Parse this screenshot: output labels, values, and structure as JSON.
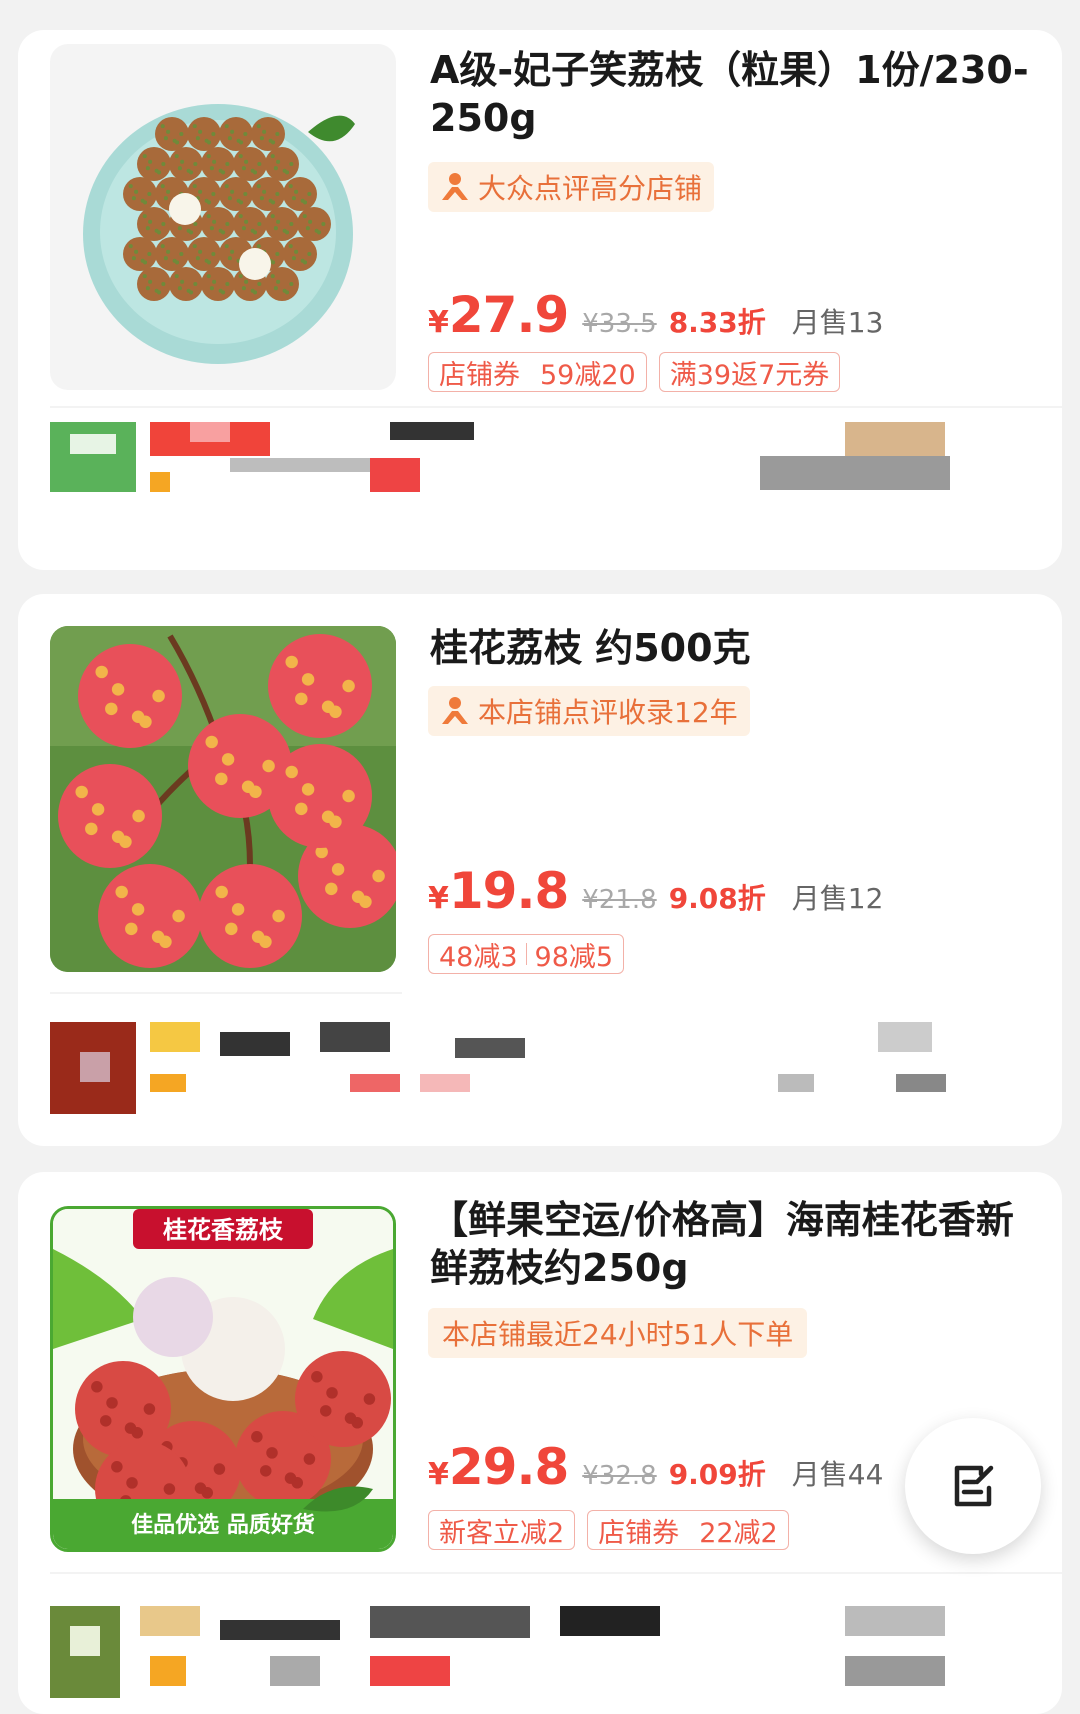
{
  "products": [
    {
      "title": "A级-妃子笑荔枝（粒果）1份/230-250g",
      "tag": "大众点评高分店铺",
      "currency": "¥",
      "price": "27.9",
      "original_price": "¥33.5",
      "discount": "8.33折",
      "monthly_sales": "月售13",
      "coupons": [
        {
          "left": "店铺券",
          "right": "59减20"
        },
        {
          "text": "满39返7元券"
        }
      ]
    },
    {
      "title": "桂花荔枝 约500克",
      "tag": "本店铺点评收录12年",
      "currency": "¥",
      "price": "19.8",
      "original_price": "¥21.8",
      "discount": "9.08折",
      "monthly_sales": "月售12",
      "coupons": [
        {
          "left": "48减3",
          "right": "98减5"
        }
      ]
    },
    {
      "title": "【鲜果空运/价格高】海南桂花香新鲜荔枝约250g",
      "tag": "本店铺最近24小时51人下单",
      "image_banner": "桂花香荔枝",
      "image_footer": "佳品优选  品质好货",
      "currency": "¥",
      "price": "29.8",
      "original_price": "¥32.8",
      "discount": "9.09折",
      "monthly_sales": "月售44",
      "coupons": [
        {
          "text": "新客立减2"
        },
        {
          "left": "店铺券",
          "right": "22减2"
        }
      ]
    }
  ],
  "fab": {
    "icon": "edit-note-icon"
  },
  "colors": {
    "price_red": "#f0463a",
    "tag_orange": "#e8703a",
    "tag_bg": "#fdf1e4"
  }
}
